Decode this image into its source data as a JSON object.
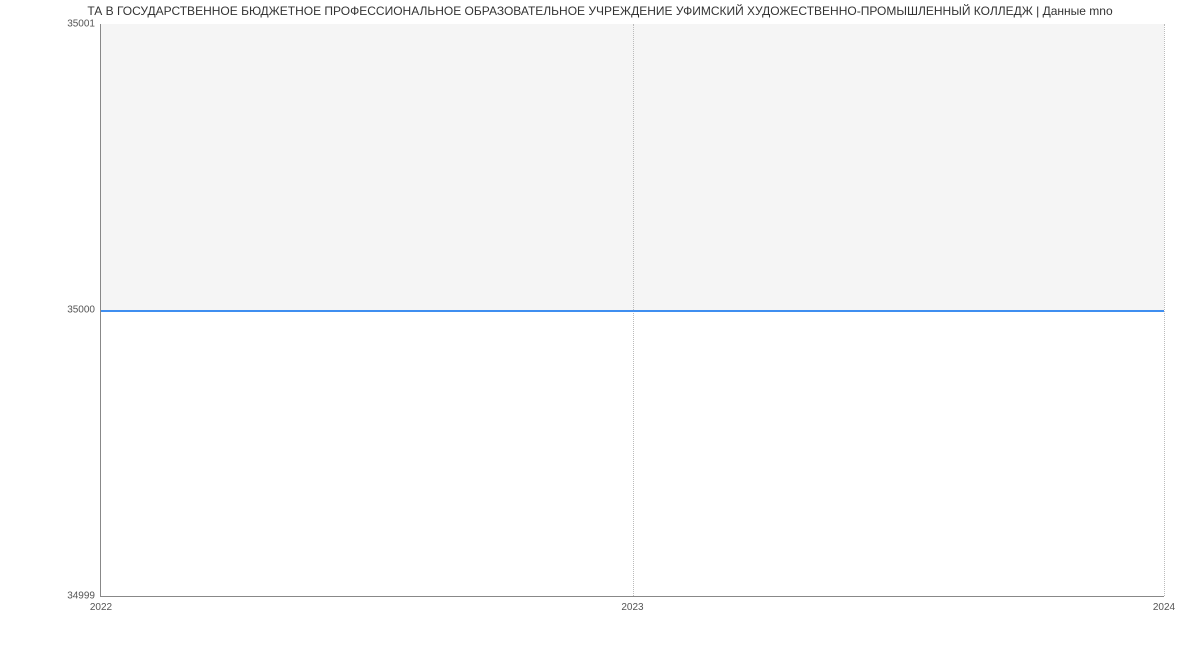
{
  "chart_data": {
    "type": "line",
    "title": "ТА В ГОСУДАРСТВЕННОЕ БЮДЖЕТНОЕ ПРОФЕССИОНАЛЬНОЕ ОБРАЗОВАТЕЛЬНОЕ УЧРЕЖДЕНИЕ УФИМСКИЙ ХУДОЖЕСТВЕННО-ПРОМЫШЛЕННЫЙ КОЛЛЕДЖ | Данные mno",
    "x": [
      "2022",
      "2023",
      "2024"
    ],
    "y_ticks": [
      "34999",
      "35000",
      "35001"
    ],
    "series": [
      {
        "name": "value",
        "values": [
          35000,
          35000,
          35000
        ]
      }
    ],
    "ylim": [
      34999,
      35001
    ],
    "xlabel": "",
    "ylabel": "",
    "bands": true,
    "grid": true
  }
}
